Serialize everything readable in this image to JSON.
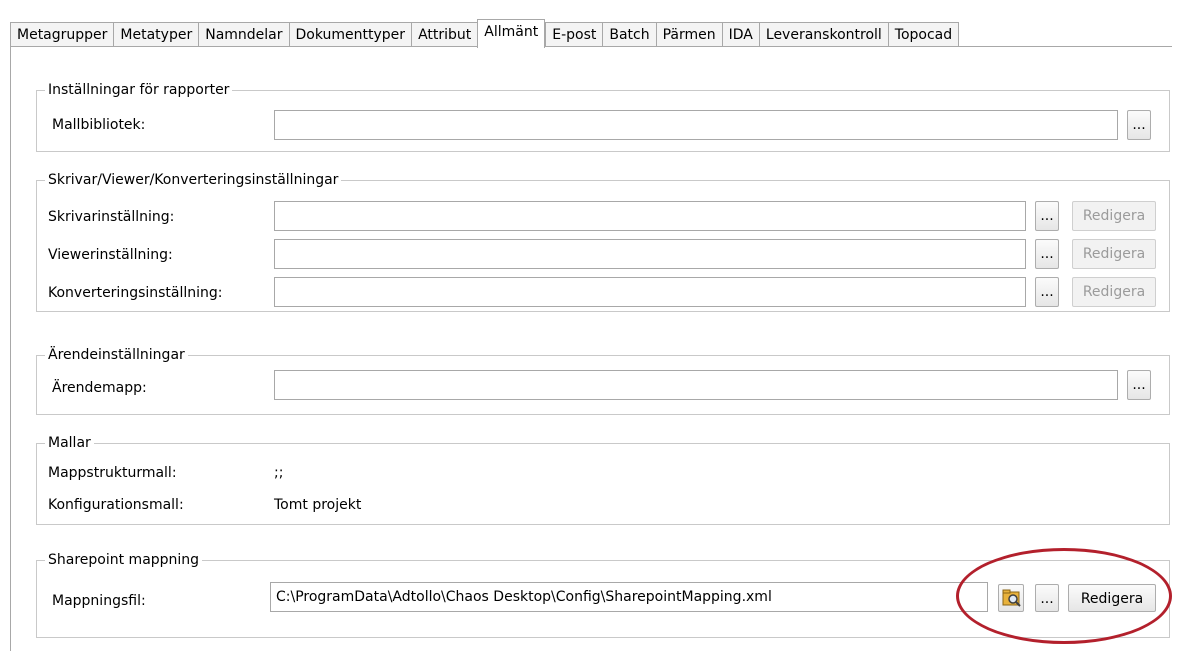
{
  "tabs": [
    "Metagrupper",
    "Metatyper",
    "Namndelar",
    "Dokumenttyper",
    "Attribut",
    "Allmänt",
    "E-post",
    "Batch",
    "Pärmen",
    "IDA",
    "Leveranskontroll",
    "Topocad"
  ],
  "rapporter": {
    "legend": "Inställningar för rapporter",
    "label": "Mallbibliotek:",
    "value": "",
    "browse": "..."
  },
  "skrivar": {
    "legend": "Skrivar/Viewer/Konverteringsinställningar",
    "rows": [
      {
        "label": "Skrivarinställning:",
        "value": "",
        "browse": "...",
        "edit": "Redigera"
      },
      {
        "label": "Viewerinställning:",
        "value": "",
        "browse": "...",
        "edit": "Redigera"
      },
      {
        "label": "Konverteringsinställning:",
        "value": "",
        "browse": "...",
        "edit": "Redigera"
      }
    ]
  },
  "arende": {
    "legend": "Ärendeinställningar",
    "label": "Ärendemapp:",
    "value": "",
    "browse": "..."
  },
  "mallar": {
    "legend": "Mallar",
    "rows": [
      {
        "label": "Mappstrukturmall:",
        "value": ";;"
      },
      {
        "label": "Konfigurationsmall:",
        "value": "Tomt projekt"
      }
    ]
  },
  "sharepoint": {
    "legend": "Sharepoint mappning",
    "label": "Mappningsfil:",
    "value": "C:\\ProgramData\\Adtollo\\Chaos Desktop\\Config\\SharepointMapping.xml",
    "icon": "folder-explore-icon",
    "browse": "...",
    "edit": "Redigera"
  },
  "colors": {
    "annotation": "#b3202c"
  }
}
